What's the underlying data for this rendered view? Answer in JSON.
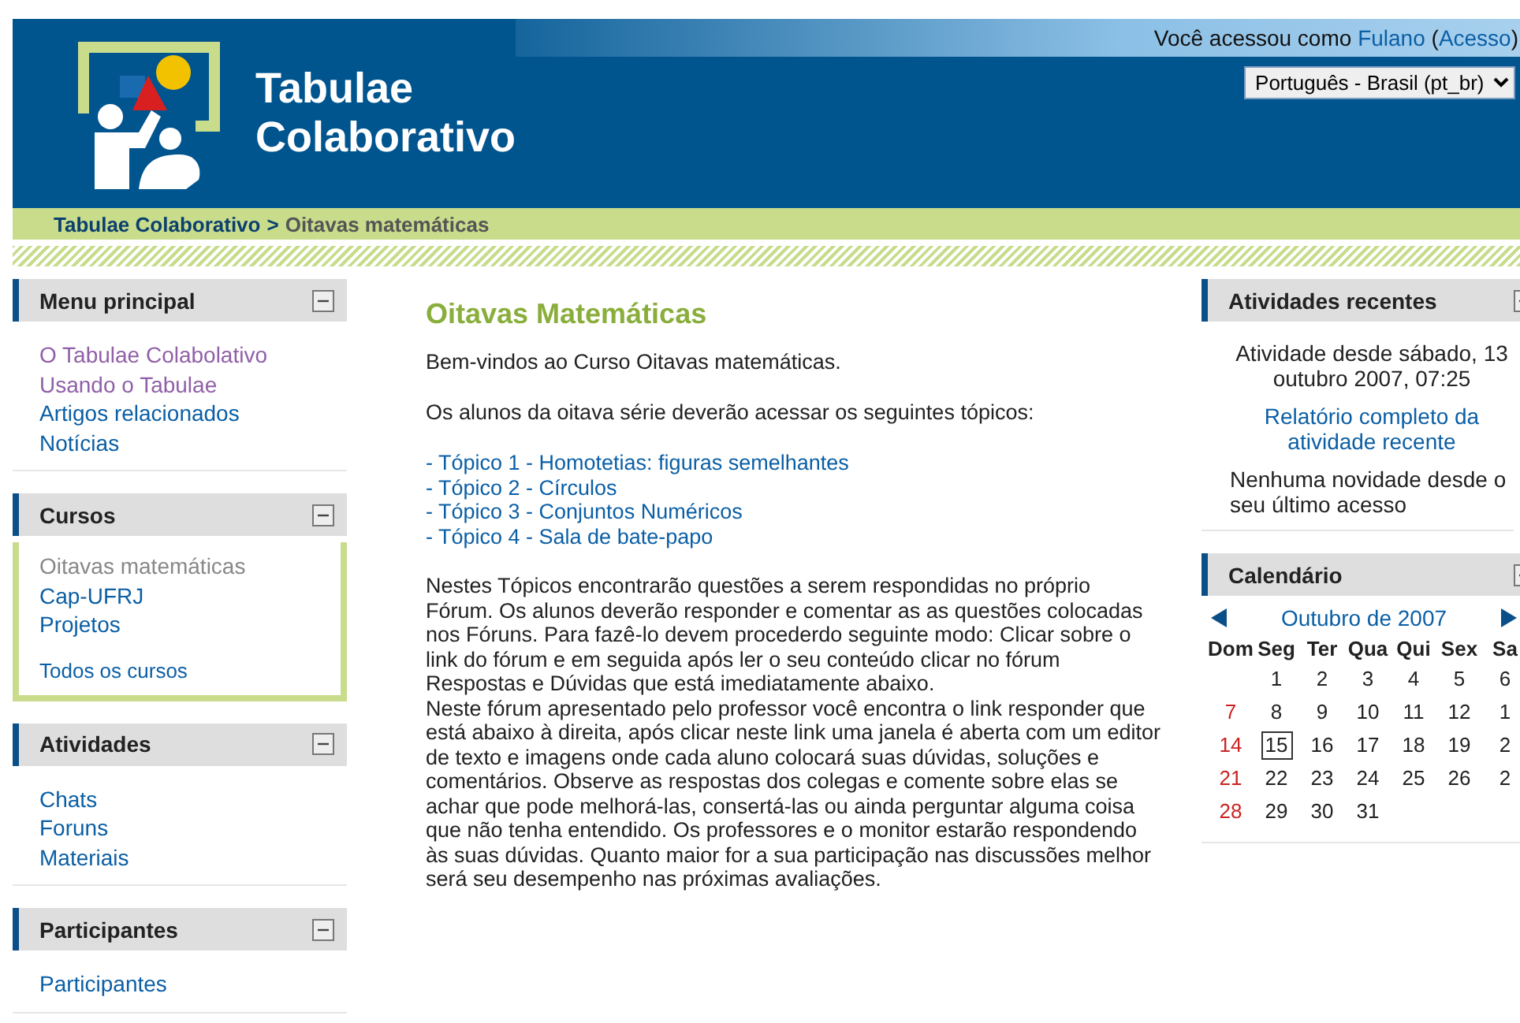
{
  "header": {
    "site_title": [
      "Tabulae",
      "Colaborativo"
    ],
    "login_prefix": "Você acessou como",
    "user": "Fulano",
    "paren_open": "(",
    "login_link": "Acesso",
    "paren_close": ")",
    "language": "Português - Brasil (pt_br)"
  },
  "breadcrumb": {
    "home": "Tabulae Colaborativo",
    "separator": ">",
    "current": "Oitavas matemáticas"
  },
  "left_blocks": [
    {
      "title": "Menu principal",
      "framed": false,
      "items": [
        {
          "label": "O Tabulae Colabolativo",
          "visited": true,
          "current": false
        },
        {
          "label": "Usando o Tabulae",
          "visited": true,
          "current": false
        },
        {
          "label": "Artigos relacionados",
          "visited": false,
          "current": false
        },
        {
          "label": "Notícias",
          "visited": false,
          "current": false
        }
      ]
    },
    {
      "title": "Cursos",
      "framed": true,
      "items": [
        {
          "label": "Oitavas matemáticas",
          "visited": false,
          "current": true
        },
        {
          "label": "Cap-UFRJ",
          "visited": false,
          "current": false
        },
        {
          "label": "Projetos",
          "visited": false,
          "current": false
        }
      ],
      "footer_link": "Todos os cursos"
    },
    {
      "title": "Atividades",
      "framed": false,
      "items": [
        {
          "label": "Chats",
          "visited": false,
          "current": false
        },
        {
          "label": "Foruns",
          "visited": false,
          "current": false
        },
        {
          "label": "Materiais",
          "visited": false,
          "current": false
        }
      ]
    },
    {
      "title": "Participantes",
      "framed": false,
      "items": [
        {
          "label": "Participantes",
          "visited": false,
          "current": false
        }
      ]
    }
  ],
  "main": {
    "title": "Oitavas Matemáticas",
    "intro": "Bem-vindos ao Curso Oitavas matemáticas.",
    "lead": "Os alunos da oitava série deverão acessar os seguintes tópicos:",
    "topics": [
      "- Tópico 1 - Homotetias: figuras semelhantes",
      "- Tópico 2 - Círculos",
      "- Tópico 3 - Conjuntos Numéricos",
      "- Tópico 4 - Sala de bate-papo"
    ],
    "body": "Nestes Tópicos encontrarão questões a serem respondidas no próprio Fórum. Os alunos deverão responder e comentar as as questões colocadas nos Fóruns. Para fazê-lo devem procederdo seguinte modo: Clicar sobre o link do fórum e em seguida após ler o seu conteúdo clicar no fórum Respostas e Dúvidas que está imediatamente abaixo.",
    "body2": "Neste fórum apresentado pelo professor você encontra o link responder que está abaixo à direita, após clicar neste link uma janela é aberta com um editor de texto e imagens onde cada aluno colocará suas dúvidas, soluções e comentários. Observe as respostas dos colegas e comente sobre elas se achar que pode melhorá-las, consertá-las ou ainda perguntar alguma coisa que não tenha entendido. Os professores e o monitor estarão respondendo às suas dúvidas. Quanto maior for a sua participação nas discussões melhor será seu desempenho nas próximas avaliações."
  },
  "recent": {
    "title": "Atividades recentes",
    "since": "Atividade desde sábado, 13 outubro 2007, 07:25",
    "report_link": "Relatório completo da atividade recente",
    "none": "Nenhuma novidade desde o seu último acesso"
  },
  "calendar": {
    "title": "Calendário",
    "month": "Outubro de 2007",
    "weekdays": [
      "Dom",
      "Seg",
      "Ter",
      "Qua",
      "Qui",
      "Sex",
      "Sa"
    ],
    "weeks": [
      [
        {
          "day": "1",
          "sunday": false,
          "today": false
        },
        {
          "day": "2",
          "sunday": false,
          "today": false
        },
        {
          "day": "3",
          "sunday": false,
          "today": false
        },
        {
          "day": "4",
          "sunday": false,
          "today": false
        },
        {
          "day": "5",
          "sunday": false,
          "today": false
        },
        {
          "day": "6",
          "sunday": false,
          "today": false
        }
      ],
      [
        {
          "day": "7",
          "sunday": true,
          "today": false
        },
        {
          "day": "8",
          "sunday": false,
          "today": false
        },
        {
          "day": "9",
          "sunday": false,
          "today": false
        },
        {
          "day": "10",
          "sunday": false,
          "today": false
        },
        {
          "day": "11",
          "sunday": false,
          "today": false
        },
        {
          "day": "12",
          "sunday": false,
          "today": false
        },
        {
          "day": "1",
          "sunday": false,
          "today": false
        }
      ],
      [
        {
          "day": "14",
          "sunday": true,
          "today": false
        },
        {
          "day": "15",
          "sunday": false,
          "today": true
        },
        {
          "day": "16",
          "sunday": false,
          "today": false
        },
        {
          "day": "17",
          "sunday": false,
          "today": false
        },
        {
          "day": "18",
          "sunday": false,
          "today": false
        },
        {
          "day": "19",
          "sunday": false,
          "today": false
        },
        {
          "day": "2",
          "sunday": false,
          "today": false
        }
      ],
      [
        {
          "day": "21",
          "sunday": true,
          "today": false
        },
        {
          "day": "22",
          "sunday": false,
          "today": false
        },
        {
          "day": "23",
          "sunday": false,
          "today": false
        },
        {
          "day": "24",
          "sunday": false,
          "today": false
        },
        {
          "day": "25",
          "sunday": false,
          "today": false
        },
        {
          "day": "26",
          "sunday": false,
          "today": false
        },
        {
          "day": "2",
          "sunday": false,
          "today": false
        }
      ],
      [
        {
          "day": "28",
          "sunday": true,
          "today": false
        },
        {
          "day": "29",
          "sunday": false,
          "today": false
        },
        {
          "day": "30",
          "sunday": false,
          "today": false
        },
        {
          "day": "31",
          "sunday": false,
          "today": false
        }
      ]
    ]
  }
}
